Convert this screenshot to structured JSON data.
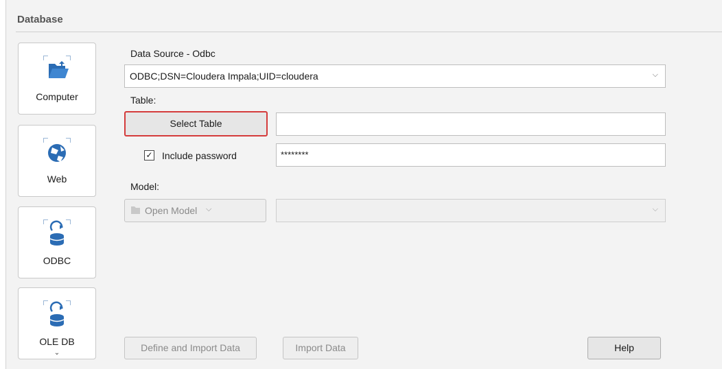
{
  "section": {
    "title": "Database"
  },
  "sources": [
    {
      "label": "Computer",
      "icon": "folder-open-icon"
    },
    {
      "label": "Web",
      "icon": "globe-icon"
    },
    {
      "label": "ODBC",
      "icon": "database-refresh-icon"
    },
    {
      "label": "OLE DB",
      "icon": "database-refresh-icon",
      "more": "⌄"
    }
  ],
  "datasource": {
    "label": "Data Source -  Odbc",
    "value": "ODBC;DSN=Cloudera Impala;UID=cloudera"
  },
  "table": {
    "label": "Table:",
    "select_button": "Select Table",
    "value": ""
  },
  "password": {
    "checkbox_label": "Include password",
    "checked": true,
    "value": "********"
  },
  "model": {
    "label": "Model:",
    "open_button": "Open Model",
    "value": ""
  },
  "footer": {
    "define_import": "Define and Import Data",
    "import": "Import Data",
    "help": "Help"
  },
  "colors": {
    "accent_blue": "#2b6cb4",
    "focus_red": "#d43b3b"
  }
}
